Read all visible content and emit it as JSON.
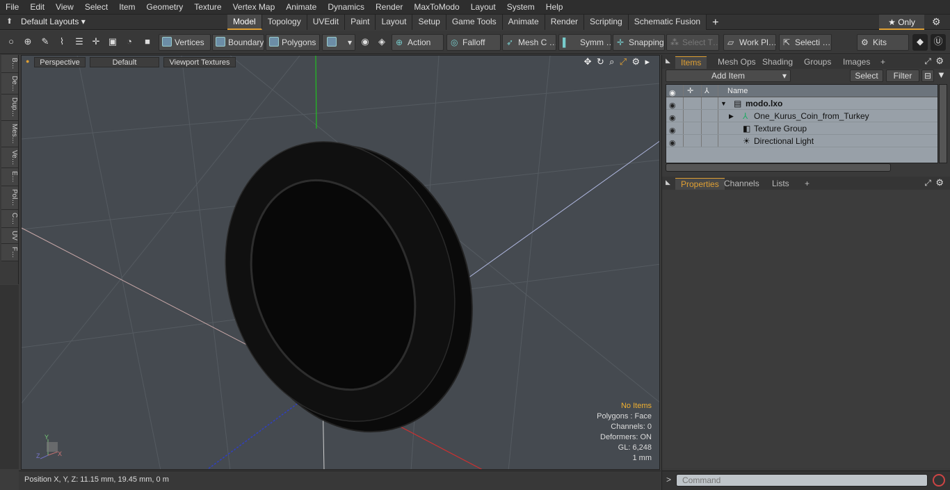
{
  "menu": [
    "File",
    "Edit",
    "View",
    "Select",
    "Item",
    "Geometry",
    "Texture",
    "Vertex Map",
    "Animate",
    "Dynamics",
    "Render",
    "MaxToModo",
    "Layout",
    "System",
    "Help"
  ],
  "layouts": {
    "current": "Default Layouts ▾",
    "tabs": [
      "Model",
      "Topology",
      "UVEdit",
      "Paint",
      "Layout",
      "Setup",
      "Game Tools",
      "Animate",
      "Render",
      "Scripting",
      "Schematic Fusion"
    ],
    "active_tab": "Model",
    "only_label": "★ Only"
  },
  "toolbar": {
    "vertices": "Vertices",
    "boundary": "Boundary",
    "polygons": "Polygons",
    "action": "Action",
    "falloff": "Falloff",
    "mesh": "Mesh C …",
    "symm": "Symm …",
    "snapping": "Snapping",
    "select_t": "Select T…",
    "work_pl": "Work Pl…",
    "selecti": "Selecti …",
    "kits": "Kits"
  },
  "left_tabs": [
    "B…",
    "De…",
    "Dup…",
    "Mes…",
    "Ve…",
    "E…",
    "Pol…",
    "C…",
    "UV",
    "F…"
  ],
  "viewport": {
    "view": "Perspective",
    "shading": "Default",
    "textures": "Viewport Textures",
    "info": {
      "items": "No Items",
      "polygons": "Polygons : Face",
      "channels": "Channels: 0",
      "deformers": "Deformers: ON",
      "gl": "GL: 6,248",
      "scale": "1 mm"
    },
    "axis_labels": {
      "x": "X",
      "y": "Y",
      "z": "Z"
    }
  },
  "status": {
    "position": "Position X, Y, Z:   11.15 mm, 19.45 mm, 0 m"
  },
  "items_panel": {
    "tabs": [
      "Items",
      "Mesh Ops",
      "Shading",
      "Groups",
      "Images"
    ],
    "active": "Items",
    "add_item": "Add Item",
    "select": "Select",
    "filter": "Filter",
    "name_col": "Name",
    "rows": [
      {
        "name": "modo.lxo",
        "level": 0
      },
      {
        "name": "One_Kurus_Coin_from_Turkey",
        "level": 1
      },
      {
        "name": "Texture Group",
        "level": 1
      },
      {
        "name": "Directional Light",
        "level": 1
      }
    ]
  },
  "props_panel": {
    "tabs": [
      "Properties",
      "Channels",
      "Lists"
    ],
    "active": "Properties"
  },
  "command": {
    "placeholder": "Command"
  },
  "colors": {
    "accent": "#e0a033",
    "viewport_bg": "#454a50"
  }
}
